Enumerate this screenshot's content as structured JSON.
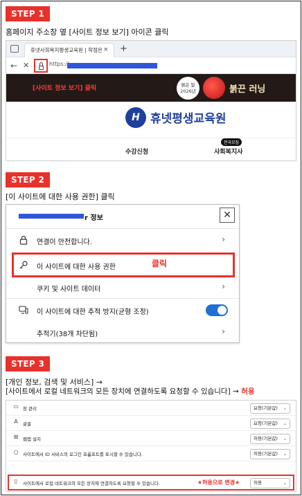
{
  "step1": {
    "badge": "STEP 1",
    "caption": "홈페이지 주소창 옆 [사이트 정보 보기] 아이콘 클릭",
    "browser": {
      "tab_title": "휴넷사회복지평생교육원 | 학점은",
      "tab_close": "×",
      "tab_new": "+",
      "url_prefix": "https://",
      "site_info_note": "[사이트 정보 보기] 클릭",
      "badge_line1": "붉은 말",
      "badge_line2": "2026년",
      "banner_title": "붉끈 러닝",
      "logo_mark": "H",
      "logo_text": "휴넷평생교육원",
      "nav_items": [
        "수강신청",
        "사회복지사"
      ],
      "nav_badge": "전국모집"
    }
  },
  "step2": {
    "badge": "STEP 2",
    "caption": "[이 사이트에 대한 사용 권한] 클릭",
    "panel": {
      "title_suffix": "r 정보",
      "close": "✕",
      "rows": [
        {
          "label": "연결이 안전합니다.",
          "icon": "lock-icon"
        },
        {
          "label": "이 사이트에 대한 사용 권한",
          "icon": "key-icon"
        },
        {
          "label": "쿠키 및 사이트 데이터",
          "icon": ""
        },
        {
          "label": "이 사이트에 대한 추적 방지(균형 조정)",
          "icon": "tracking-icon"
        },
        {
          "label": "추적기(38개 차단됨)",
          "icon": ""
        }
      ],
      "click_label": "클릭"
    }
  },
  "step3": {
    "badge": "STEP 3",
    "caption_line1": "[개인 정보, 검색 및 서비스] →",
    "caption_line2_prefix": "[사이트에서 로컬 네트워크의 모든 장치에 연결하도록 요청할 수 있습니다] →",
    "caption_line2_highlight": "허용",
    "rows": [
      {
        "label": "창 관리",
        "value": "요청(기본값)",
        "icon": "window-icon"
      },
      {
        "label": "글꼴",
        "value": "요청(기본값)",
        "icon": "font-icon"
      },
      {
        "label": "웹앱 설치",
        "value": "허용(기본값)",
        "icon": "app-install-icon"
      },
      {
        "label": "사이트에서 ID 서비스의 로그인 프롬프트를 표시할 수 있습니다.",
        "value": "허용(기본값)",
        "icon": "user-icon"
      },
      {
        "label": "사이트에서 로컬 네트워크의 모든 장치에 연결하도록 요청할 수 있습니다.",
        "value": "허용",
        "icon": "device-icon"
      }
    ],
    "change_note": "★허용으로 변경★"
  },
  "colors": {
    "accent": "#e8312a",
    "toggle": "#1f6fd6",
    "redaction": "#2f57d8",
    "logo": "#1f3f9e"
  }
}
